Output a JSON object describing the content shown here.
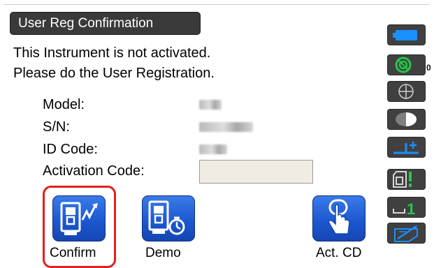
{
  "title": "User Reg Confirmation",
  "message": {
    "line1": "This Instrument is not activated.",
    "line2": "Please do the User Registration."
  },
  "fields": {
    "model_label": "Model:",
    "sn_label": "S/N:",
    "id_label": "ID Code:",
    "activation_label": "Activation Code:",
    "activation_value": ""
  },
  "softkeys": [
    {
      "label": "Confirm",
      "icon": "instrument-signal-icon",
      "highlighted": true
    },
    {
      "label": "Demo",
      "icon": "instrument-timer-icon",
      "highlighted": false
    },
    {
      "label": "Act. CD",
      "icon": "press-finger-icon",
      "highlighted": false
    }
  ],
  "status_bar": {
    "items": [
      "battery-icon",
      "tilt-compensation-icon",
      "target-icon",
      "prism-icon",
      "elevation-offset-icon",
      "instrument-face-icon",
      "sd-channel-icon",
      "keyboard-input-icon"
    ],
    "tilt_value": "0",
    "channel_value": "1"
  },
  "colors": {
    "title_bg": "#3a3a3a",
    "button_blue": "#1d58d0",
    "highlight": "#e0201f",
    "status_green": "#22c84a",
    "status_cyan": "#1a8fff"
  }
}
